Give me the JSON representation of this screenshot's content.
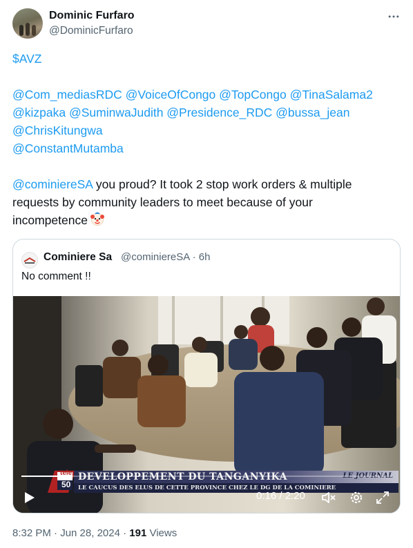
{
  "author": {
    "name": "Dominic Furfaro",
    "handle": "@DominicFurfaro"
  },
  "tweet": {
    "cashtag": "$AVZ",
    "mentions": {
      "line1": [
        "@Com_mediasRDC",
        "@VoiceOfCongo",
        "@TopCongo",
        "@TinaSalama2"
      ],
      "line2": [
        "@kizpaka",
        "@SuminwaJudith",
        "@Presidence_RDC",
        "@bussa_jean"
      ],
      "line3": [
        "@ChrisKitungwa"
      ],
      "line4": [
        "@ConstantMutamba"
      ]
    },
    "reply_mention": "@cominiereSA",
    "body_line1": " you proud? It took 2 stop work orders & multiple",
    "body_line2": "requests by community leaders to meet because of your",
    "body_line3": "incompetence",
    "emoji": "clown-face"
  },
  "quote": {
    "name": "Cominiere Sa",
    "meta": "@cominiereSA · 6h",
    "text": "No comment !!",
    "video": {
      "banner_title": "DEVELOPPEMENT DU TANGANYIKA",
      "banner_subtitle": "LE CAUCUS DES ELUS DE CETTE PROVINCE CHEZ LE DG DE LA COMINIERE",
      "banner_journal": "LE JOURNAL",
      "channel_logo_top": "tele",
      "channel_logo_bottom": "50",
      "time": "0:16 / 2:20",
      "progress_fraction": 0.114
    }
  },
  "footer": {
    "datetime": "8:32 PM · Jun 28, 2024 · ",
    "views_count": "191",
    "views_label": " Views"
  },
  "colors": {
    "link": "#1d9bf0",
    "text": "#0f1419",
    "muted": "#536471",
    "border": "#cfd9de"
  }
}
